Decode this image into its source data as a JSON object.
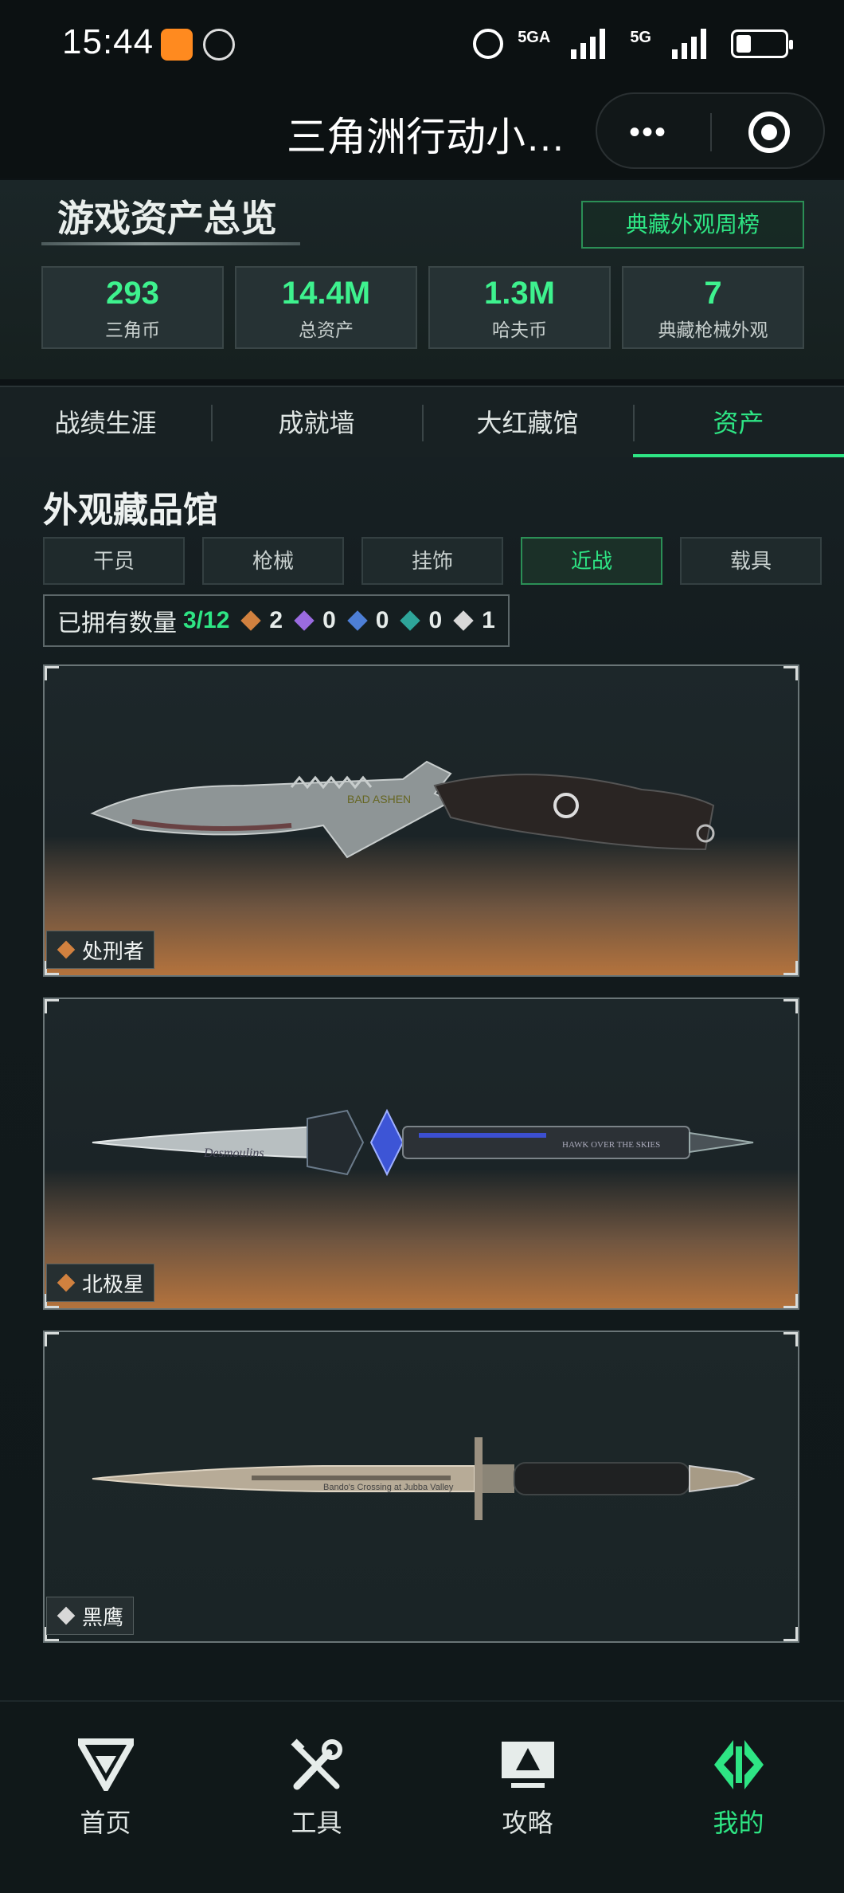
{
  "status_bar": {
    "time": "15:44",
    "signal1": "5GA",
    "signal2": "5G"
  },
  "title_bar": {
    "title": "三角洲行动小…",
    "more": "•••"
  },
  "overview": {
    "title": "游戏资产总览",
    "rank_button": "典藏外观周榜",
    "stats": [
      {
        "value": "293",
        "label": "三角币"
      },
      {
        "value": "14.4M",
        "label": "总资产"
      },
      {
        "value": "1.3M",
        "label": "哈夫币"
      },
      {
        "value": "7",
        "label": "典藏枪械外观"
      }
    ]
  },
  "main_tabs": [
    "战绩生涯",
    "成就墙",
    "大红藏馆",
    "资产"
  ],
  "active_main_tab": "资产",
  "collection": {
    "title": "外观藏品馆",
    "sub_tabs": [
      "干员",
      "枪械",
      "挂饰",
      "近战",
      "载具"
    ],
    "active_sub_tab": "近战",
    "owned_label": "已拥有数量",
    "owned_count": "3/12",
    "rarity_counts": [
      {
        "color": "orange",
        "count": "2"
      },
      {
        "color": "purple",
        "count": "0"
      },
      {
        "color": "blue",
        "count": "0"
      },
      {
        "color": "teal",
        "count": "0"
      },
      {
        "color": "white",
        "count": "1"
      }
    ],
    "items": [
      {
        "name": "处刑者",
        "rarity": "orange",
        "engraving": "BAD ASHEN"
      },
      {
        "name": "北极星",
        "rarity": "orange",
        "engraving": "Desmoulins",
        "engraving2": "HAWK OVER THE SKIES"
      },
      {
        "name": "黑鹰",
        "rarity": "white",
        "engraving": "Bando's Crossing at Jubba Valley"
      }
    ]
  },
  "bottom_nav": [
    {
      "label": "首页",
      "icon": "home-icon"
    },
    {
      "label": "工具",
      "icon": "tools-icon"
    },
    {
      "label": "攻略",
      "icon": "guide-icon"
    },
    {
      "label": "我的",
      "icon": "profile-icon"
    }
  ],
  "active_bottom_nav": "我的",
  "colors": {
    "accent": "#2ee584",
    "background": "#0d1315",
    "orange_rarity": "#d1813f"
  }
}
